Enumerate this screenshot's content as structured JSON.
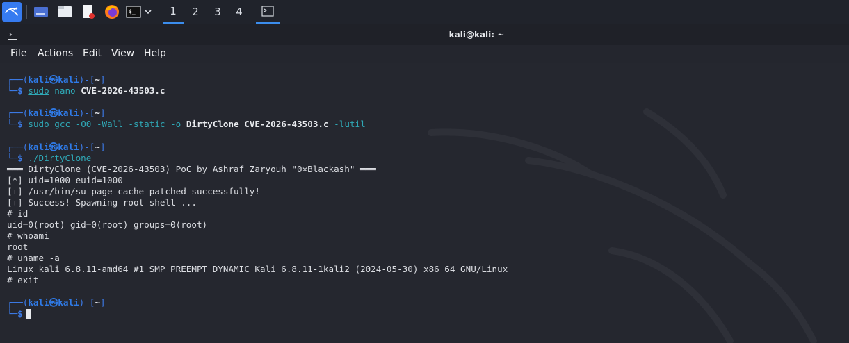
{
  "taskbar": {
    "icons": [
      "kali-menu-icon",
      "desktop-icon",
      "file-manager-icon",
      "text-editor-icon",
      "firefox-icon",
      "terminal-icon",
      "chevron-down-icon"
    ],
    "workspaces": [
      "1",
      "2",
      "3",
      "4"
    ],
    "active_workspace": "1"
  },
  "window": {
    "title": "kali@kali: ~",
    "menu": [
      "File",
      "Actions",
      "Edit",
      "View",
      "Help"
    ]
  },
  "prompt": {
    "user": "kali",
    "at": "㉿",
    "host": "kali",
    "dir": "~",
    "symbol": "$"
  },
  "terminal": {
    "cmd1": {
      "program": "sudo",
      "rest_plain": " nano ",
      "file": "CVE-2026-43503.c"
    },
    "cmd2": {
      "program": "sudo",
      "tool": " gcc -O0 -Wall -static -o ",
      "out": "DirtyClone",
      "file": " CVE-2026-43503.c",
      "lib": " -lutil"
    },
    "cmd3": "./DirtyClone",
    "output": [
      "═══ DirtyClone (CVE-2026-43503) PoC by Ashraf Zaryouh \"0×Blackash\" ═══",
      "[*] uid=1000 euid=1000",
      "[+] /usr/bin/su page-cache patched successfully!",
      "[+] Success! Spawning root shell ...",
      "# id",
      "uid=0(root) gid=0(root) groups=0(root)",
      "# whoami",
      "root",
      "# uname -a",
      "Linux kali 6.8.11-amd64 #1 SMP PREEMPT_DYNAMIC Kali 6.8.11-1kali2 (2024-05-30) x86_64 GNU/Linux",
      "# exit"
    ]
  },
  "colors": {
    "accent": "#367bf0",
    "prompt_blue": "#2f7be8",
    "command_cyan": "#2fa8b6"
  }
}
